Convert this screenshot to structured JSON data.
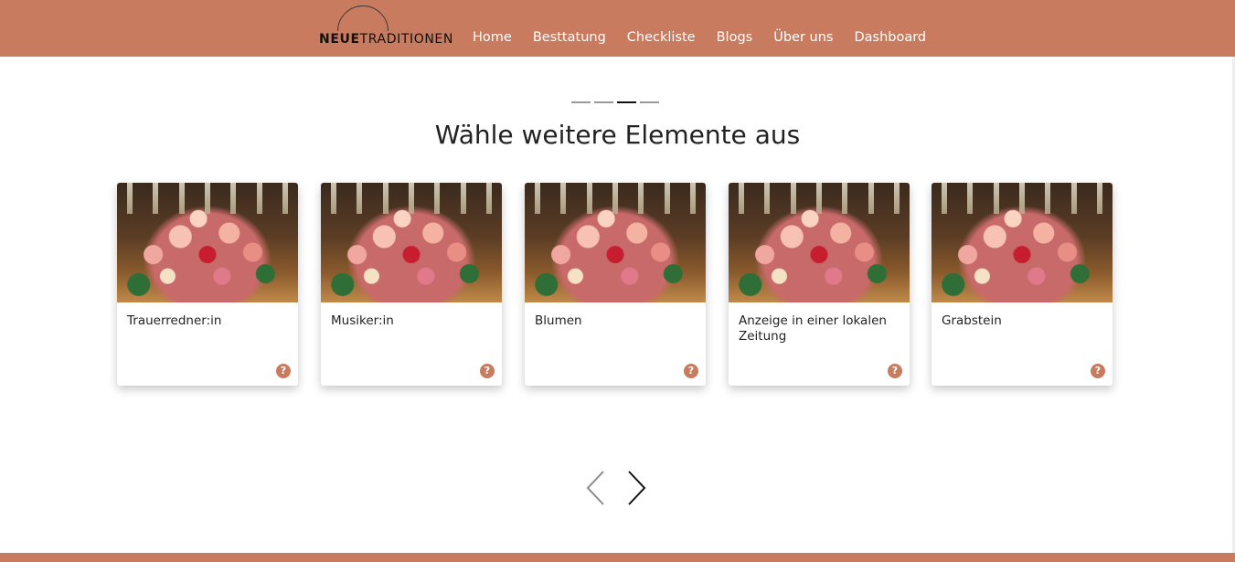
{
  "header": {
    "logo_bold": "NEUE",
    "logo_light": "TRADITIONEN",
    "nav": [
      "Home",
      "Besttatung",
      "Checkliste",
      "Blogs",
      "Über uns",
      "Dashboard"
    ]
  },
  "steps": {
    "total": 4,
    "current": 3
  },
  "main": {
    "heading": "Wähle weitere Elemente aus",
    "cards": [
      {
        "title": "Trauerredner:in"
      },
      {
        "title": "Musiker:in"
      },
      {
        "title": "Blumen"
      },
      {
        "title": "Anzeige in einer lokalen Zeitung"
      },
      {
        "title": "Grabstein"
      }
    ],
    "help_symbol": "?"
  },
  "carousel": {
    "prev_icon": "chevron-left-icon",
    "next_icon": "chevron-right-icon"
  },
  "colors": {
    "accent": "#c87b5e",
    "text": "#222222",
    "background": "#ffffff"
  }
}
